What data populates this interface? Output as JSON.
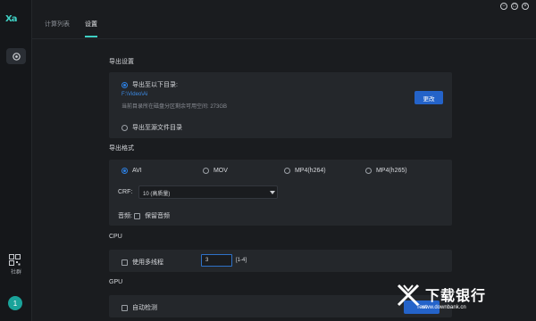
{
  "app": {
    "logo": "Xa"
  },
  "tabs": [
    {
      "label": "计算列表",
      "active": false
    },
    {
      "label": "设置",
      "active": true
    }
  ],
  "window_controls": {
    "minimize": "−",
    "restore": "□",
    "close": "×"
  },
  "sidebar": {
    "community_label": "社群",
    "avatar_text": "1"
  },
  "export_settings": {
    "title": "导出设置",
    "option_dir_label": "导出至以下目录:",
    "dir_path": "F:\\Video\\Ai",
    "space_info": "当前目录所在磁盘分区剩余可用空间: 273GB",
    "change_button": "更改",
    "option_source_label": "导出至源文件目录"
  },
  "export_format": {
    "title": "导出格式",
    "formats": [
      {
        "label": "AVI",
        "selected": true
      },
      {
        "label": "MOV",
        "selected": false
      },
      {
        "label": "MP4(h264)",
        "selected": false
      },
      {
        "label": "MP4(h265)",
        "selected": false
      }
    ],
    "crf_label": "CRF:",
    "crf_value": "10 (高质量)",
    "audio_label": "音频:",
    "keep_audio_label": "保留音频"
  },
  "cpu": {
    "title": "CPU",
    "multithread_label": "使用多线程",
    "thread_value": "3",
    "range_hint": "[1-4]"
  },
  "gpu": {
    "title": "GPU",
    "auto_detect_label": "自动检测",
    "test_button": "Test"
  },
  "watermark": {
    "brand": "下载银行",
    "url": "www.downbank.cn"
  },
  "colors": {
    "accent": "#3fd0c4",
    "primary_button": "#2463c9",
    "panel": "#24272b",
    "background": "#1a1c1f"
  }
}
